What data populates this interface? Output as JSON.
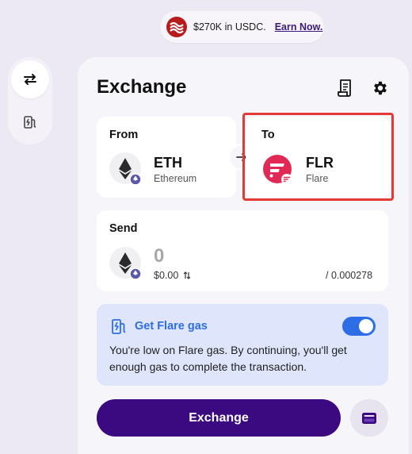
{
  "promo": {
    "text": "$270K in USDC.",
    "link": "Earn Now."
  },
  "rail": {
    "items": [
      {
        "icon": "swap-arrows-icon"
      },
      {
        "icon": "gas-pump-icon"
      }
    ]
  },
  "header": {
    "title": "Exchange",
    "icons": [
      "receipt-icon",
      "gear-icon"
    ]
  },
  "from": {
    "label": "From",
    "symbol": "ETH",
    "name": "Ethereum",
    "icon": "ethereum-icon"
  },
  "to": {
    "label": "To",
    "symbol": "FLR",
    "name": "Flare",
    "icon": "flare-icon"
  },
  "send": {
    "label": "Send",
    "amount": "0",
    "fiat": "$0.00",
    "balance": "/ 0.000278"
  },
  "gas": {
    "title": "Get Flare gas",
    "text": "You're low on Flare gas. By continuing, you'll get enough gas to complete the transaction.",
    "enabled": true
  },
  "actions": {
    "exchange_label": "Exchange",
    "wallet_icon": "wallet-icon"
  },
  "colors": {
    "primary": "#3b0a80",
    "accent_blue": "#2d6ee6",
    "flare_red": "#e02a55",
    "highlight": "#e53935"
  }
}
